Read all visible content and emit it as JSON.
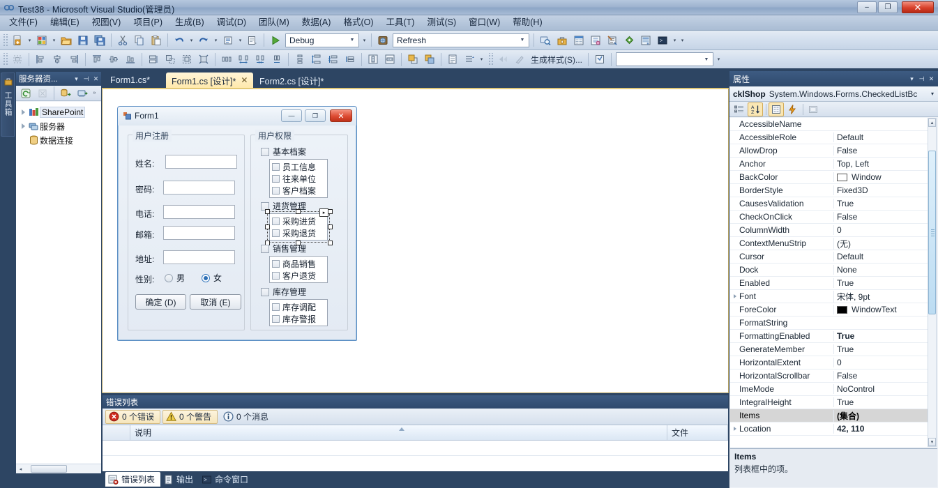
{
  "window": {
    "title": "Test38 - Microsoft Visual Studio(管理员)",
    "icon": "visual-studio-icon",
    "minimize": "–",
    "maximize": "❐",
    "close": "✕"
  },
  "menubar": {
    "items": [
      {
        "label": "文件(F)"
      },
      {
        "label": "编辑(E)"
      },
      {
        "label": "视图(V)"
      },
      {
        "label": "项目(P)"
      },
      {
        "label": "生成(B)"
      },
      {
        "label": "调试(D)"
      },
      {
        "label": "团队(M)"
      },
      {
        "label": "数据(A)"
      },
      {
        "label": "格式(O)"
      },
      {
        "label": "工具(T)"
      },
      {
        "label": "测试(S)"
      },
      {
        "label": "窗口(W)"
      },
      {
        "label": "帮助(H)"
      }
    ]
  },
  "toolbar_standard": {
    "config_combo": {
      "value": "Debug",
      "arrow": "▼"
    },
    "refresh_combo": {
      "value": "Refresh",
      "arrow": "▼"
    },
    "icons": [
      "new-item-icon",
      "new-project-icon",
      "open-file-icon",
      "save-icon",
      "save-all-icon",
      "cut-icon",
      "copy-icon",
      "paste-icon",
      "undo-icon",
      "redo-icon",
      "navigate-back-icon",
      "comment-icon",
      "start-debug-icon",
      "find-in-files-icon",
      "toolbox-icon",
      "properties-window-icon",
      "solution-explorer-icon",
      "object-browser-icon",
      "team-explorer-icon",
      "server-explorer-icon",
      "class-view-icon",
      "command-window-icon"
    ]
  },
  "toolbar_layout": {
    "build_style_label": "生成样式(S)...",
    "style_combo": {
      "value": "",
      "arrow": "▼"
    },
    "icons": [
      "align-to-grid-icon",
      "align-lefts-icon",
      "align-centers-icon",
      "align-rights-icon",
      "align-tops-icon",
      "align-middles-icon",
      "align-bottoms-icon",
      "make-same-width-icon",
      "make-same-size-icon",
      "size-to-grid-icon",
      "size-to-fit-icon",
      "horiz-spacing-make-equal-icon",
      "horiz-spacing-increase-icon",
      "horiz-spacing-decrease-icon",
      "horiz-spacing-remove-icon",
      "vert-spacing-make-equal-icon",
      "vert-spacing-increase-icon",
      "vert-spacing-decrease-icon",
      "vert-spacing-remove-icon",
      "center-horizontally-icon",
      "center-vertically-icon",
      "bring-to-front-icon",
      "send-to-back-icon",
      "tab-order-icon",
      "order-icon"
    ]
  },
  "left_strip": {
    "toolbox_tab": {
      "label": "工具箱",
      "icon": "toolbox-icon"
    }
  },
  "server_explorer": {
    "title": "服务器资...",
    "window_buttons": [
      {
        "name": "dropdown-icon",
        "glyph": "▾"
      },
      {
        "name": "pin-icon",
        "glyph": "⊣"
      },
      {
        "name": "close-icon",
        "glyph": "✕"
      }
    ],
    "toolbar_icons": [
      "refresh-icon",
      "stop-icon",
      "connect-to-database-icon",
      "connect-to-server-icon",
      "overflow-icon"
    ],
    "tree": [
      {
        "label": "SharePoint",
        "icon": "sharepoint-icon",
        "expandable": true,
        "selected": true
      },
      {
        "label": "服务器",
        "icon": "server-icon",
        "expandable": true,
        "selected": false
      },
      {
        "label": "数据连接",
        "icon": "data-connections-icon",
        "expandable": false,
        "selected": false
      }
    ],
    "hscroll": {
      "left_arrow": "◂",
      "right_arrow": "▸"
    }
  },
  "document_tabs": [
    {
      "label": "Form1.cs*",
      "active": false,
      "closeable": false
    },
    {
      "label": "Form1.cs [设计]*",
      "active": true,
      "closeable": true,
      "close_glyph": "✕"
    },
    {
      "label": "Form2.cs [设计]*",
      "active": false,
      "closeable": false
    }
  ],
  "form_designer": {
    "form": {
      "title": "Form1",
      "icon": "form-icon",
      "minimize": "—",
      "maximize": "❐",
      "close": "✕"
    },
    "group_register": {
      "title": "用户注册",
      "fields": [
        {
          "label": "姓名:",
          "value": ""
        },
        {
          "label": "密码:",
          "value": ""
        },
        {
          "label": "电话:",
          "value": ""
        },
        {
          "label": "邮箱:",
          "value": ""
        },
        {
          "label": "地址:",
          "value": ""
        }
      ],
      "gender": {
        "label": "性别:",
        "options": [
          {
            "label": "男",
            "checked": false
          },
          {
            "label": "女",
            "checked": true
          }
        ]
      },
      "buttons": [
        {
          "label": "确定 (D)"
        },
        {
          "label": "取消 (E)"
        }
      ]
    },
    "group_permissions": {
      "title": "用户权限",
      "sections": [
        {
          "checkbox": {
            "label": "基本档案",
            "checked": false
          },
          "items": [
            {
              "label": "员工信息",
              "checked": false
            },
            {
              "label": "往来单位",
              "checked": false
            },
            {
              "label": "客户档案",
              "checked": false
            }
          ],
          "selected": false
        },
        {
          "checkbox": {
            "label": "进货管理",
            "checked": false
          },
          "items": [
            {
              "label": "采购进货",
              "checked": false
            },
            {
              "label": "采购退货",
              "checked": false
            }
          ],
          "selected": true,
          "smart_tag": "▸"
        },
        {
          "checkbox": {
            "label": "销售管理",
            "checked": false
          },
          "items": [
            {
              "label": "商品销售",
              "checked": false
            },
            {
              "label": "客户退货",
              "checked": false
            }
          ],
          "selected": false
        },
        {
          "checkbox": {
            "label": "库存管理",
            "checked": false
          },
          "items": [
            {
              "label": "库存调配",
              "checked": false
            },
            {
              "label": "库存警报",
              "checked": false
            }
          ],
          "selected": false
        }
      ]
    }
  },
  "error_list": {
    "title": "错误列表",
    "filters": [
      {
        "label": "0 个错误",
        "badge": "error-badge-icon",
        "active": true
      },
      {
        "label": "0 个警告",
        "badge": "warning-badge-icon",
        "active": true
      },
      {
        "label": "0 个消息",
        "badge": "info-badge-icon",
        "active": false
      }
    ],
    "columns": [
      "",
      "说明",
      "文件"
    ],
    "rows": [],
    "tabs": [
      {
        "label": "错误列表",
        "icon": "error-list-icon",
        "active": true
      },
      {
        "label": "输出",
        "icon": "output-icon",
        "active": false
      },
      {
        "label": "命令窗口",
        "icon": "command-window-icon",
        "active": false
      }
    ]
  },
  "properties": {
    "title": "属性",
    "window_buttons": [
      {
        "name": "dropdown-icon",
        "glyph": "▾"
      },
      {
        "name": "pin-icon",
        "glyph": "⊣"
      },
      {
        "name": "close-icon",
        "glyph": "✕"
      }
    ],
    "object_name": "cklShop",
    "object_type": "System.Windows.Forms.CheckedListBc",
    "object_dropdown": "▾",
    "toolbar_buttons": [
      {
        "name": "categorized-button",
        "state": "off"
      },
      {
        "name": "alphabetical-button",
        "state": "on"
      },
      {
        "name": "properties-button",
        "state": "on"
      },
      {
        "name": "events-button",
        "state": "off"
      },
      {
        "name": "property-pages-button",
        "state": "disabled"
      }
    ],
    "rows": [
      {
        "name": "AccessibleName",
        "value": "",
        "expandable": false,
        "bold": false,
        "selected": false
      },
      {
        "name": "AccessibleRole",
        "value": "Default",
        "expandable": false,
        "bold": false,
        "selected": false
      },
      {
        "name": "AllowDrop",
        "value": "False",
        "expandable": false,
        "bold": false,
        "selected": false
      },
      {
        "name": "Anchor",
        "value": "Top, Left",
        "expandable": false,
        "bold": false,
        "selected": false
      },
      {
        "name": "BackColor",
        "value": "Window",
        "expandable": false,
        "bold": false,
        "selected": false,
        "swatch": "#ffffff"
      },
      {
        "name": "BorderStyle",
        "value": "Fixed3D",
        "expandable": false,
        "bold": false,
        "selected": false
      },
      {
        "name": "CausesValidation",
        "value": "True",
        "expandable": false,
        "bold": false,
        "selected": false
      },
      {
        "name": "CheckOnClick",
        "value": "False",
        "expandable": false,
        "bold": false,
        "selected": false
      },
      {
        "name": "ColumnWidth",
        "value": "0",
        "expandable": false,
        "bold": false,
        "selected": false
      },
      {
        "name": "ContextMenuStrip",
        "value": "(无)",
        "expandable": false,
        "bold": false,
        "selected": false
      },
      {
        "name": "Cursor",
        "value": "Default",
        "expandable": false,
        "bold": false,
        "selected": false
      },
      {
        "name": "Dock",
        "value": "None",
        "expandable": false,
        "bold": false,
        "selected": false
      },
      {
        "name": "Enabled",
        "value": "True",
        "expandable": false,
        "bold": false,
        "selected": false
      },
      {
        "name": "Font",
        "value": "宋体, 9pt",
        "expandable": true,
        "bold": false,
        "selected": false
      },
      {
        "name": "ForeColor",
        "value": "WindowText",
        "expandable": false,
        "bold": false,
        "selected": false,
        "swatch": "#000000"
      },
      {
        "name": "FormatString",
        "value": "",
        "expandable": false,
        "bold": false,
        "selected": false
      },
      {
        "name": "FormattingEnabled",
        "value": "True",
        "expandable": false,
        "bold": true,
        "selected": false
      },
      {
        "name": "GenerateMember",
        "value": "True",
        "expandable": false,
        "bold": false,
        "selected": false
      },
      {
        "name": "HorizontalExtent",
        "value": "0",
        "expandable": false,
        "bold": false,
        "selected": false
      },
      {
        "name": "HorizontalScrollbar",
        "value": "False",
        "expandable": false,
        "bold": false,
        "selected": false
      },
      {
        "name": "ImeMode",
        "value": "NoControl",
        "expandable": false,
        "bold": false,
        "selected": false
      },
      {
        "name": "IntegralHeight",
        "value": "True",
        "expandable": false,
        "bold": false,
        "selected": false
      },
      {
        "name": "Items",
        "value": "(集合)",
        "expandable": false,
        "bold": false,
        "selected": true
      },
      {
        "name": "Location",
        "value": "42, 110",
        "expandable": true,
        "bold": true,
        "selected": false
      }
    ],
    "description": {
      "title": "Items",
      "text": "列表框中的项。"
    },
    "scroll": {
      "up": "▴",
      "down": "▾"
    }
  },
  "colors": {
    "vs_chrome": "#2d4563",
    "accent_tab": "#ffe9ac",
    "panel_header": "#33507a"
  }
}
